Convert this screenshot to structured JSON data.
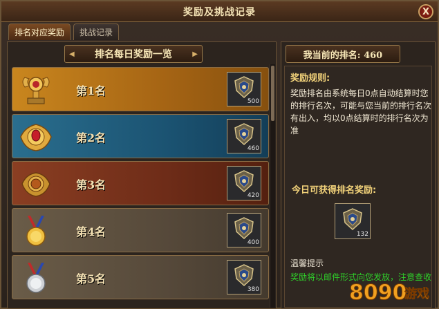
{
  "window": {
    "title": "奖励及挑战记录",
    "close_label": "X"
  },
  "tabs": [
    {
      "label": "排名对应奖励",
      "active": true
    },
    {
      "label": "挑战记录",
      "active": false
    }
  ],
  "left": {
    "banner": "排名每日奖励一览",
    "rows": [
      {
        "rank": "第1名",
        "medal_icon": "gold-trophy-icon",
        "reward_icon": "shield-emblem-icon",
        "qty": "500"
      },
      {
        "rank": "第2名",
        "medal_icon": "gold-ruby-crest-icon",
        "reward_icon": "shield-emblem-icon",
        "qty": "460"
      },
      {
        "rank": "第3名",
        "medal_icon": "bronze-crest-icon",
        "reward_icon": "shield-emblem-icon",
        "qty": "420"
      },
      {
        "rank": "第4名",
        "medal_icon": "gold-medal-icon",
        "reward_icon": "shield-emblem-icon",
        "qty": "400"
      },
      {
        "rank": "第5名",
        "medal_icon": "silver-medal-icon",
        "reward_icon": "shield-emblem-icon",
        "qty": "380"
      }
    ]
  },
  "right": {
    "my_rank": "我当前的排名: 460",
    "rule_head": "奖励规则:",
    "rule_text": "奖励排名由系统每日0点自动结算时您的排行名次，可能与您当前的排行名次有出入，均以0点结算时的排行名次为准",
    "today_head": "今日可获得排名奖励:",
    "today_qty": "132",
    "tip_head": "温馨提示",
    "tip_text": "奖励将以邮件形式向您发放，注意查收"
  },
  "watermark": "8090游戏",
  "colors": {
    "accent": "#f3d37a",
    "tip_green": "#2fd12a",
    "frame": "#6b5437"
  }
}
